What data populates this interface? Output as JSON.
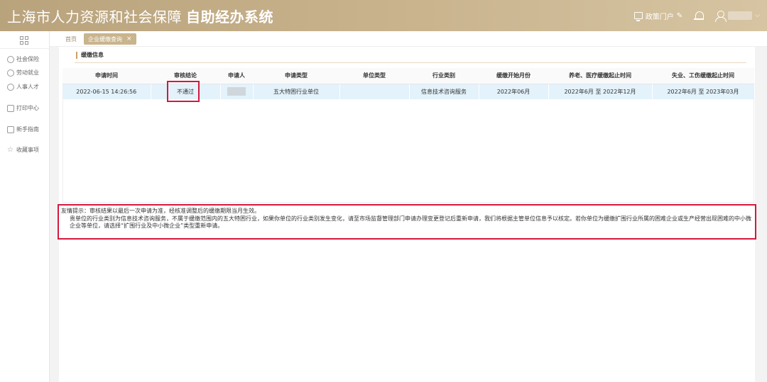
{
  "header": {
    "title": "上海市人力资源和社会保障",
    "subtitle": "自助经办系统",
    "portal_label": "政策门户",
    "user_name": ""
  },
  "sidebar": {
    "items": [
      {
        "label": "社会保险",
        "icon": "social-insurance-icon"
      },
      {
        "label": "劳动就业",
        "icon": "employment-icon"
      },
      {
        "label": "人事人才",
        "icon": "personnel-icon"
      },
      {
        "label": "打印中心",
        "icon": "printer-icon"
      },
      {
        "label": "新手指南",
        "icon": "guide-icon"
      },
      {
        "label": "收藏事项",
        "icon": "star-icon"
      }
    ]
  },
  "tabs": {
    "home": "首页",
    "active": "企业缓缴查询"
  },
  "section": {
    "title": "缓缴信息"
  },
  "table": {
    "headers": [
      "申请时间",
      "审核结论",
      "申请人",
      "申请类型",
      "单位类型",
      "行业类别",
      "缓缴开始月份",
      "养老、医疗缓缴起止时间",
      "失业、工伤缓缴起止时间"
    ],
    "rows": [
      [
        "2022-06-15 14:26:56",
        "不通过",
        "",
        "五大特困行业单位",
        "",
        "信息技术咨询服务",
        "2022年06月",
        "2022年6月 至 2022年12月",
        "2022年6月 至 2023年03月"
      ]
    ]
  },
  "tip": {
    "line1": "友情提示：审核结果以最后一次申请为准，经核准调整后的缓缴期限当月生效。",
    "line2": "贵单位的行业类别为信息技术咨询服务，不属于缓缴范围内的五大特困行业，如果你单位的行业类别发生变化，请至市场监督管理部门申请办理变更登记后重新申请，我们将根据主管单位信息予以核定。若你单位为缓缴扩围行业所属的困难企业或生产经营出现困难的中小微企业等单位，请选择“扩围行业及中小微企业”类型重新申请。"
  },
  "colors": {
    "header_bg": "#c3ad86",
    "accent": "#c8b48d",
    "highlight_red": "#d4183c",
    "row_bg": "#e3f2fb"
  }
}
